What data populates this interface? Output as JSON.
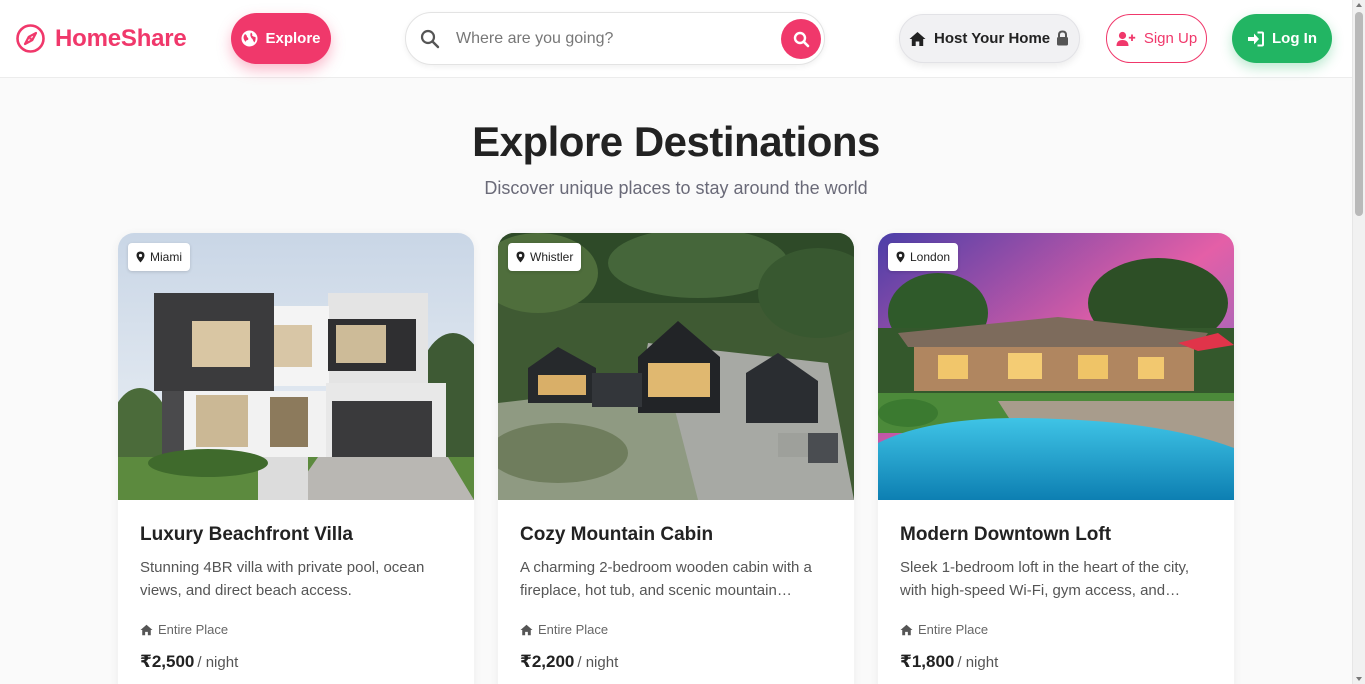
{
  "header": {
    "brand": "HomeShare",
    "brand_color": "#f0386b",
    "explore_label": "Explore",
    "search": {
      "placeholder": "Where are you going?"
    },
    "host_label": "Host Your Home",
    "signup_label": "Sign Up",
    "login_label": "Log In",
    "login_color": "#22b563"
  },
  "hero": {
    "title": "Explore Destinations",
    "subtitle": "Discover unique places to stay around the world"
  },
  "listings": [
    {
      "location": "Miami",
      "title": "Luxury Beachfront Villa",
      "description": "Stunning 4BR villa with private pool, ocean views, and direct beach access.",
      "type": "Entire Place",
      "price": "₹2,500",
      "unit": "/ night",
      "image": "modern two-storey white and grey house with garage"
    },
    {
      "location": "Whistler",
      "title": "Cozy Mountain Cabin",
      "description": "A charming 2-bedroom wooden cabin with a fireplace, hot tub, and scenic mountain…",
      "type": "Entire Place",
      "price": "₹2,200",
      "unit": "/ night",
      "image": "aerial view of dark modern cabins surrounded by forest"
    },
    {
      "location": "London",
      "title": "Modern Downtown Loft",
      "description": "Sleek 1-bedroom loft in the heart of the city, with high-speed Wi-Fi, gym access, and…",
      "type": "Entire Place",
      "price": "₹1,800",
      "unit": "/ night",
      "image": "ranch style house with swimming pool at sunset"
    }
  ]
}
